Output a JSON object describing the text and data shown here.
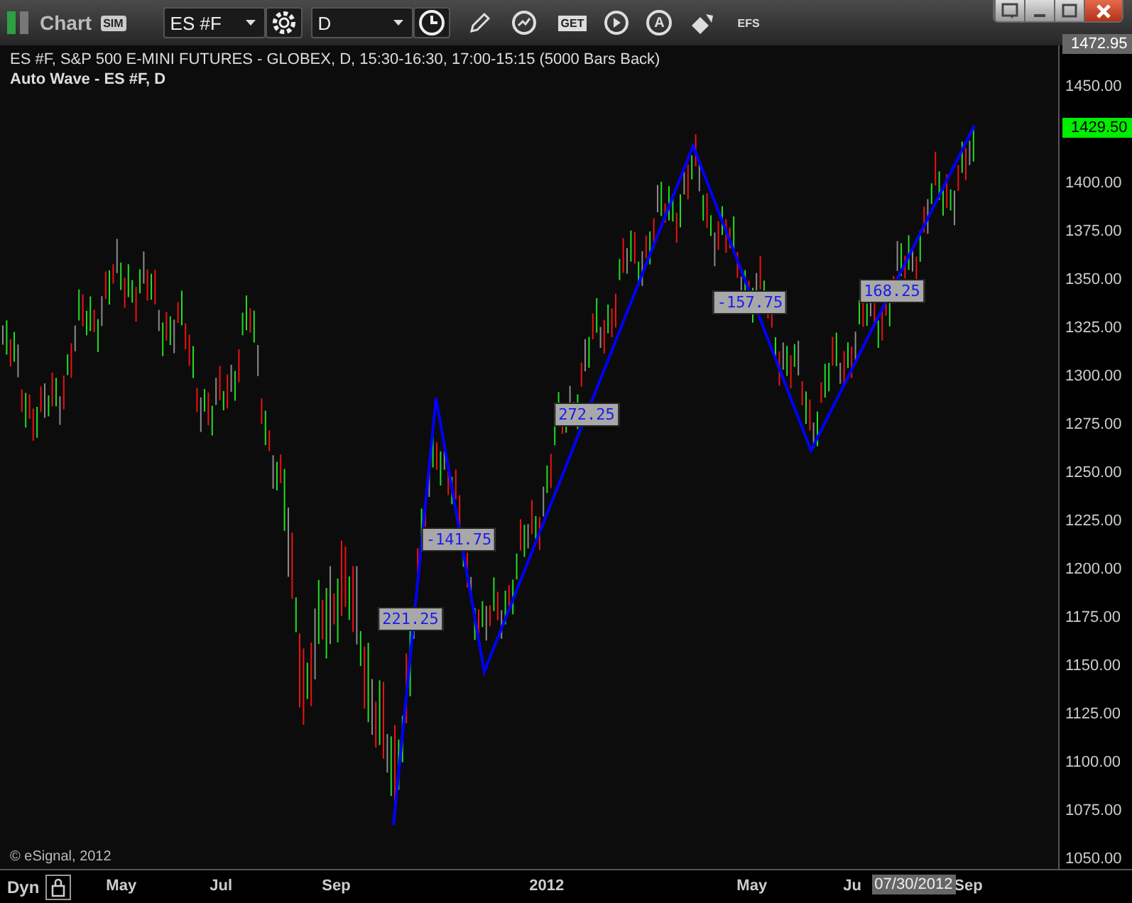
{
  "window": {
    "title": "Chart",
    "badge": "SIM",
    "controls": [
      {
        "kind": "menu"
      },
      {
        "kind": "minimize"
      },
      {
        "kind": "maximize"
      },
      {
        "kind": "close"
      }
    ]
  },
  "toolbar": {
    "symbol": "ES #F",
    "interval": "D",
    "tools": [
      {
        "kind": "pencil"
      },
      {
        "kind": "refresh"
      },
      {
        "kind": "text",
        "label": "GET"
      },
      {
        "kind": "play"
      },
      {
        "kind": "circle-letter",
        "label": "A"
      },
      {
        "kind": "arrows"
      },
      {
        "kind": "plain",
        "label": "EFS"
      }
    ]
  },
  "chart": {
    "header": "ES #F, S&P 500 E-MINI FUTURES - GLOBEX, D, 15:30-16:30, 17:00-15:15 (5000 Bars Back)",
    "study": "Auto Wave - ES #F, D",
    "copyright": "© eSignal, 2012",
    "price_tags": [
      {
        "kind": "high",
        "label": "1472.95"
      },
      {
        "kind": "last",
        "label": "1429.50"
      }
    ],
    "wave_labels": [
      "221.25",
      "-141.75",
      "272.25",
      "-157.75",
      "168.25"
    ],
    "price_axis": [
      "1450.00",
      "1400.00",
      "1375.00",
      "1350.00",
      "1325.00",
      "1300.00",
      "1275.00",
      "1250.00",
      "1225.00",
      "1200.00",
      "1175.00",
      "1150.00",
      "1125.00",
      "1100.00",
      "1075.00",
      "1050.00"
    ],
    "time_axis": [
      "May",
      "Jul",
      "Sep",
      "2012",
      "May",
      "Ju",
      "Sep"
    ],
    "cursor_date": "07/30/2012"
  },
  "bottom_bar": {
    "label": "Dyn"
  }
}
